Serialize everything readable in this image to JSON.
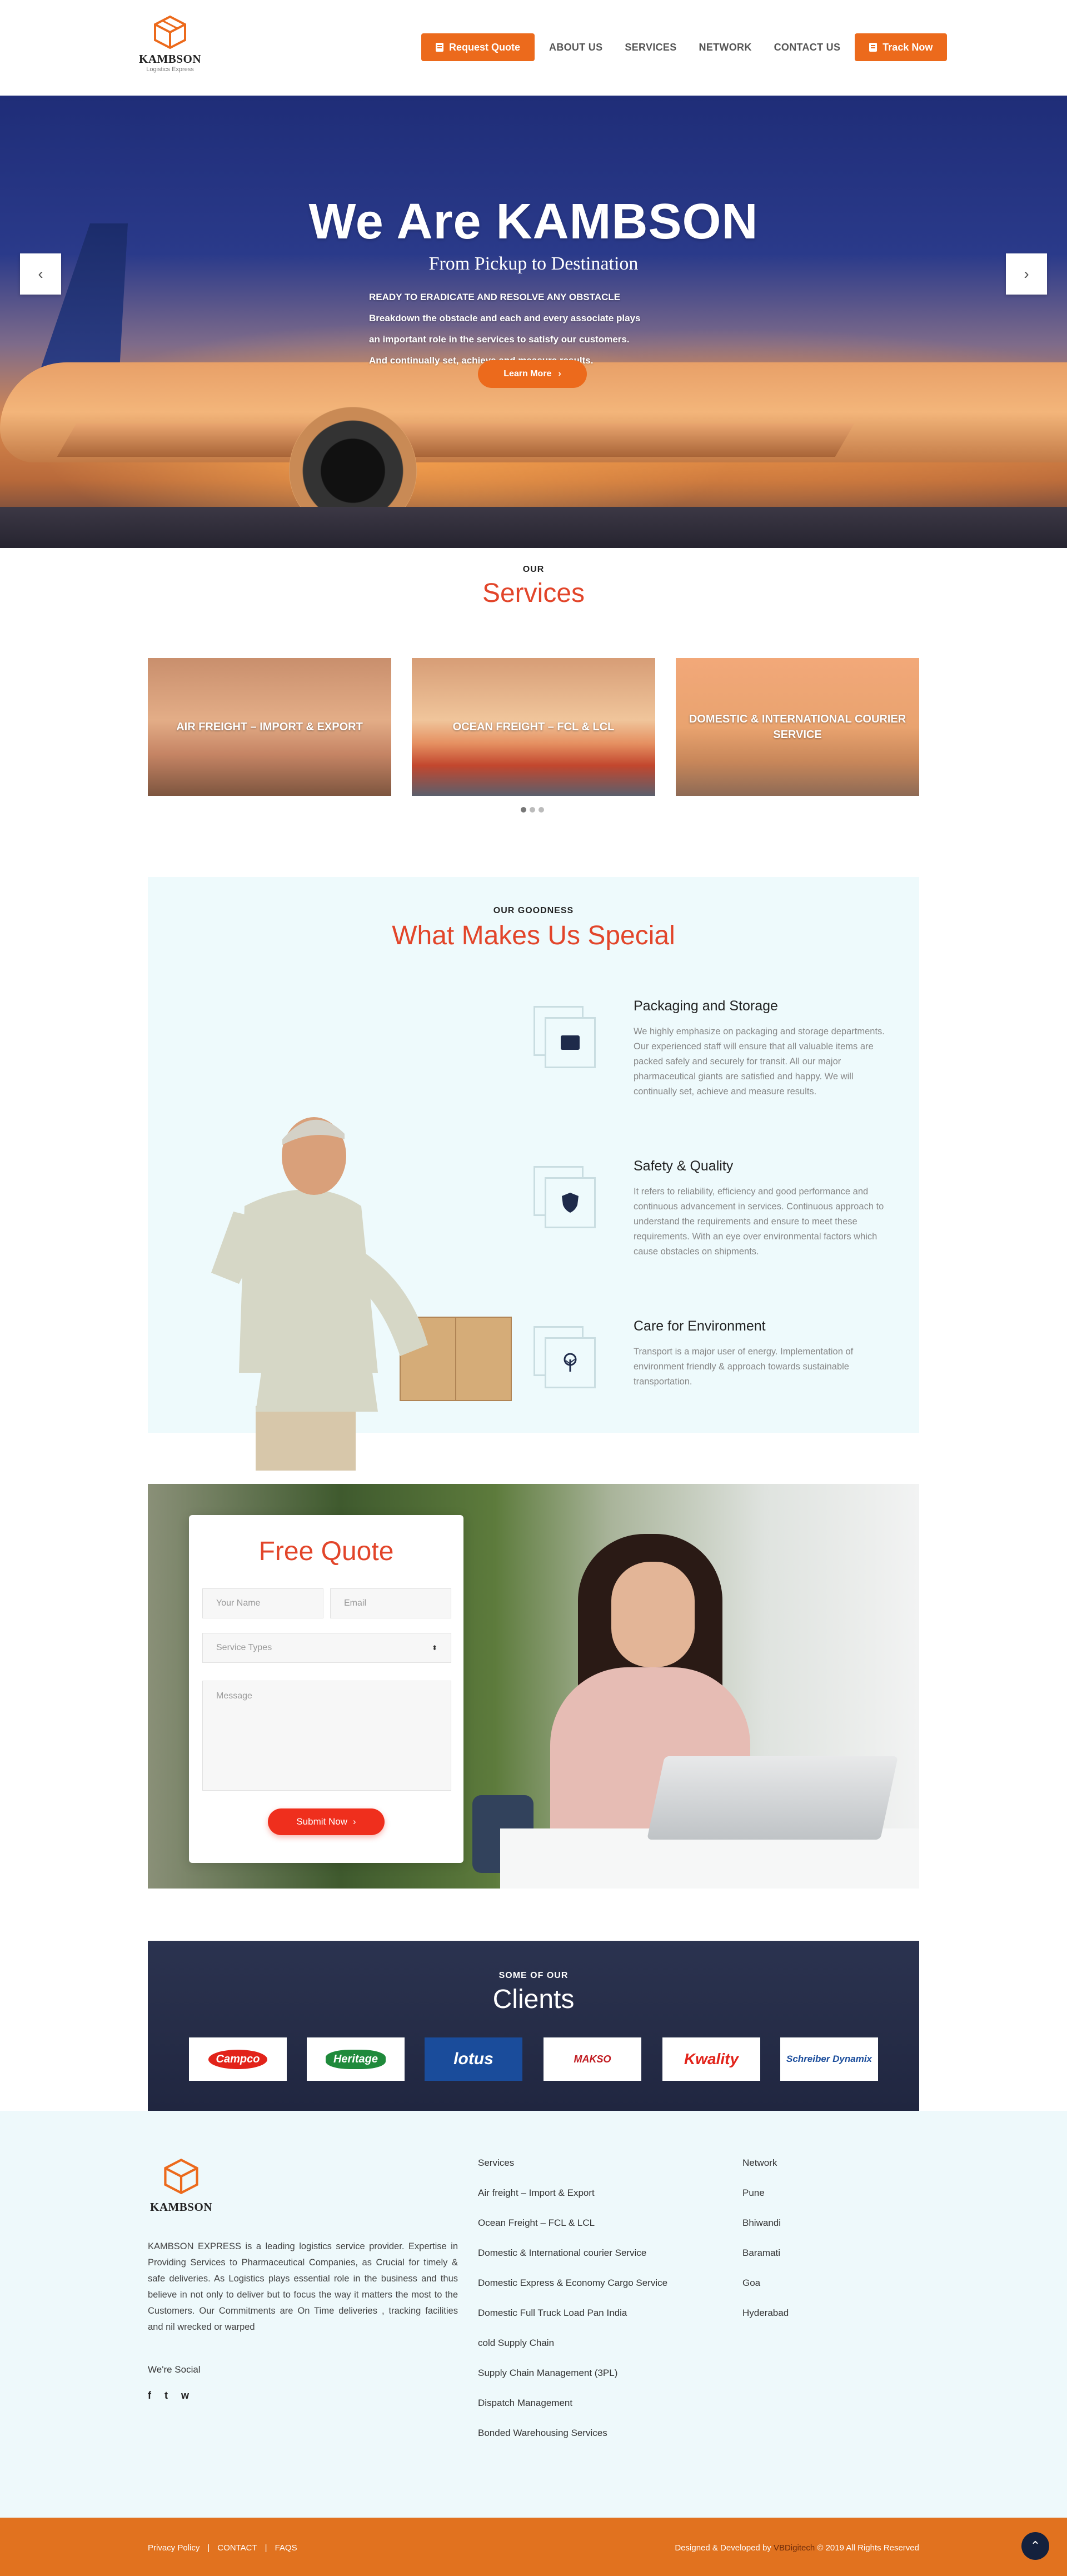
{
  "header": {
    "logo_name": "KAMBSON",
    "logo_sub": "Logistics Express",
    "request_quote": "Request Quote",
    "nav": [
      "ABOUT US",
      "SERVICES",
      "NETWORK",
      "CONTACT US"
    ],
    "track_now": "Track Now"
  },
  "hero": {
    "title": "We Are KAMBSON",
    "subtitle": "From Pickup to Destination",
    "lines": [
      "READY TO ERADICATE AND RESOLVE ANY OBSTACLE",
      "Breakdown the obstacle and each and every associate plays",
      "an important role in the services to satisfy our customers.",
      "And continually set, achieve and measure results."
    ],
    "button": "Learn More",
    "prev_arrow": "‹",
    "next_arrow": "›"
  },
  "services": {
    "small": "OUR",
    "big": "Services",
    "cards": [
      "AIR FREIGHT – IMPORT & EXPORT",
      "OCEAN FREIGHT – FCL & LCL",
      "DOMESTIC & INTERNATIONAL COURIER SERVICE"
    ]
  },
  "special": {
    "small": "OUR GOODNESS",
    "big": "What Makes Us Special",
    "features": [
      {
        "title": "Packaging and Storage",
        "text": "We highly emphasize on packaging and storage departments. Our experienced staff will ensure that all valuable items are packed safely and securely for transit. All our major pharmaceutical giants are satisfied and happy. We will continually set, achieve and measure results."
      },
      {
        "title": "Safety & Quality",
        "text": "It refers to reliability, efficiency and good performance and continuous advancement in services. Continuous approach to understand the requirements and ensure to meet these requirements. With an eye over environmental factors which cause obstacles on shipments."
      },
      {
        "title": "Care for Environment",
        "text": "Transport is a major user of energy. Implementation of environment friendly & approach towards sustainable transportation."
      }
    ]
  },
  "quote": {
    "title": "Free Quote",
    "name_placeholder": "Your Name",
    "email_placeholder": "Email",
    "service_placeholder": "Service Types",
    "message_placeholder": "Message",
    "submit": "Submit Now"
  },
  "clients": {
    "small": "SOME OF OUR",
    "big": "Clients",
    "logos": [
      "Campco",
      "Heritage",
      "lotus",
      "MAKSO",
      "Kwality",
      "Schreiber Dynamix"
    ]
  },
  "footer": {
    "logo_name": "KAMBSON",
    "about": "KAMBSON EXPRESS is a leading logistics service provider. Expertise in Providing Services to Pharmaceutical Companies, as Crucial for timely & safe deliveries. As Logistics plays essential role in the business and thus believe in not only to deliver but to focus the way it matters the most to the Customers. Our Commitments are On Time deliveries , tracking facilities and nil wrecked or warped",
    "social_label": "We're Social",
    "social_icons": [
      "f",
      "t",
      "w"
    ],
    "services_col": [
      "Services",
      "Air freight – Import & Export",
      "Ocean Freight – FCL & LCL",
      "Domestic & International courier Service",
      "Domestic Express & Economy Cargo Service",
      "Domestic Full Truck Load Pan India",
      "cold Supply Chain",
      "Supply Chain Management (3PL)",
      "Dispatch Management",
      "Bonded Warehousing Services"
    ],
    "network_col": [
      "Network",
      "Pune",
      "Bhiwandi",
      "Baramati",
      "Goa",
      "Hyderabad"
    ],
    "bottom_links": [
      "Privacy Policy",
      "|",
      "CONTACT",
      "|",
      "FAQS"
    ],
    "credit_pre": "Designed & Developed by",
    "credit_name": "VBDigitech",
    "credit_post": "© 2019 All Rights Reserved"
  },
  "colors": {
    "accent": "#ec6a1c",
    "heading_red": "#e2452a",
    "navy": "#14213d"
  }
}
